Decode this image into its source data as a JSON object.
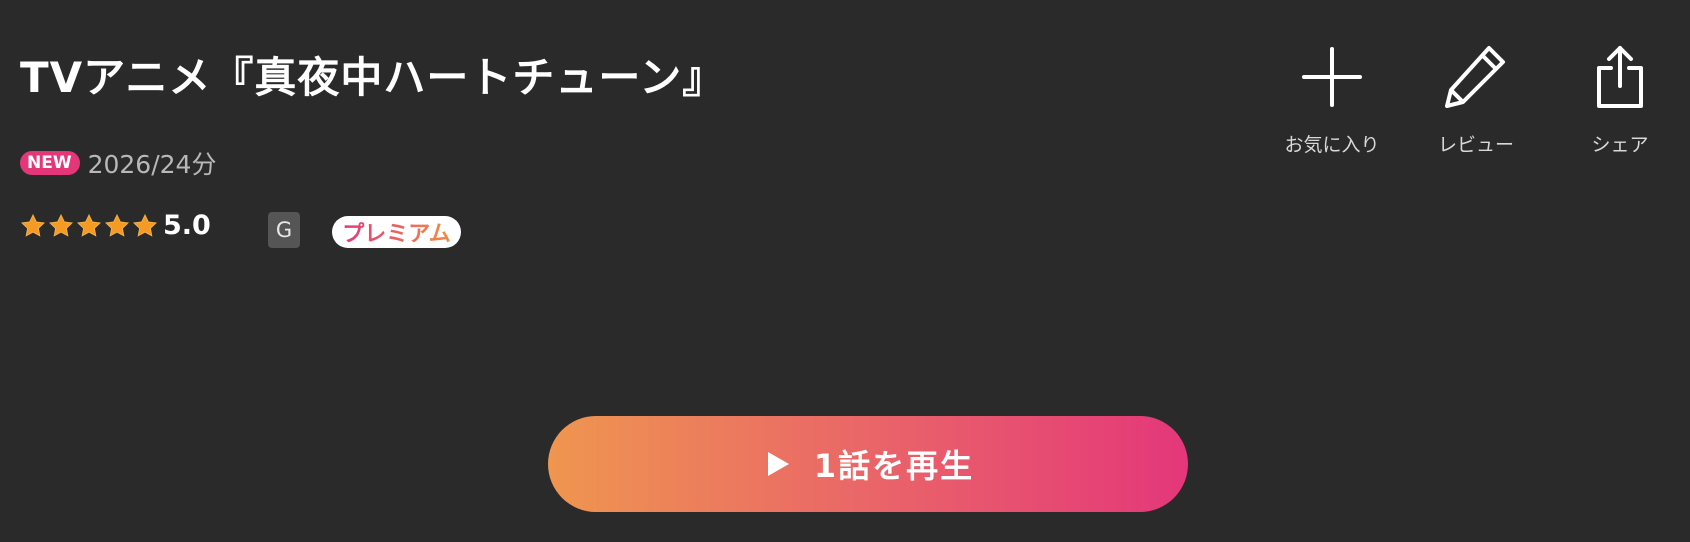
{
  "title": "TVアニメ『真夜中ハートチューン』",
  "meta": {
    "new_badge": "NEW",
    "year_duration": "2026/24分"
  },
  "rating": {
    "stars": 5,
    "value": "5.0",
    "star_color": "#f59a23"
  },
  "age_rating": "G",
  "premium_label": "プレミアム",
  "actions": {
    "favorite": {
      "label": "お気に入り",
      "icon": "plus-icon"
    },
    "review": {
      "label": "レビュー",
      "icon": "pencil-icon"
    },
    "share": {
      "label": "シェア",
      "icon": "share-icon"
    }
  },
  "play_button": {
    "label": "1話を再生",
    "icon": "play-icon",
    "gradient": [
      "#ef964f",
      "#e4377a"
    ]
  },
  "colors": {
    "background": "#2a2a2a",
    "new_badge": "#e4377a",
    "g_badge": "#555555"
  }
}
